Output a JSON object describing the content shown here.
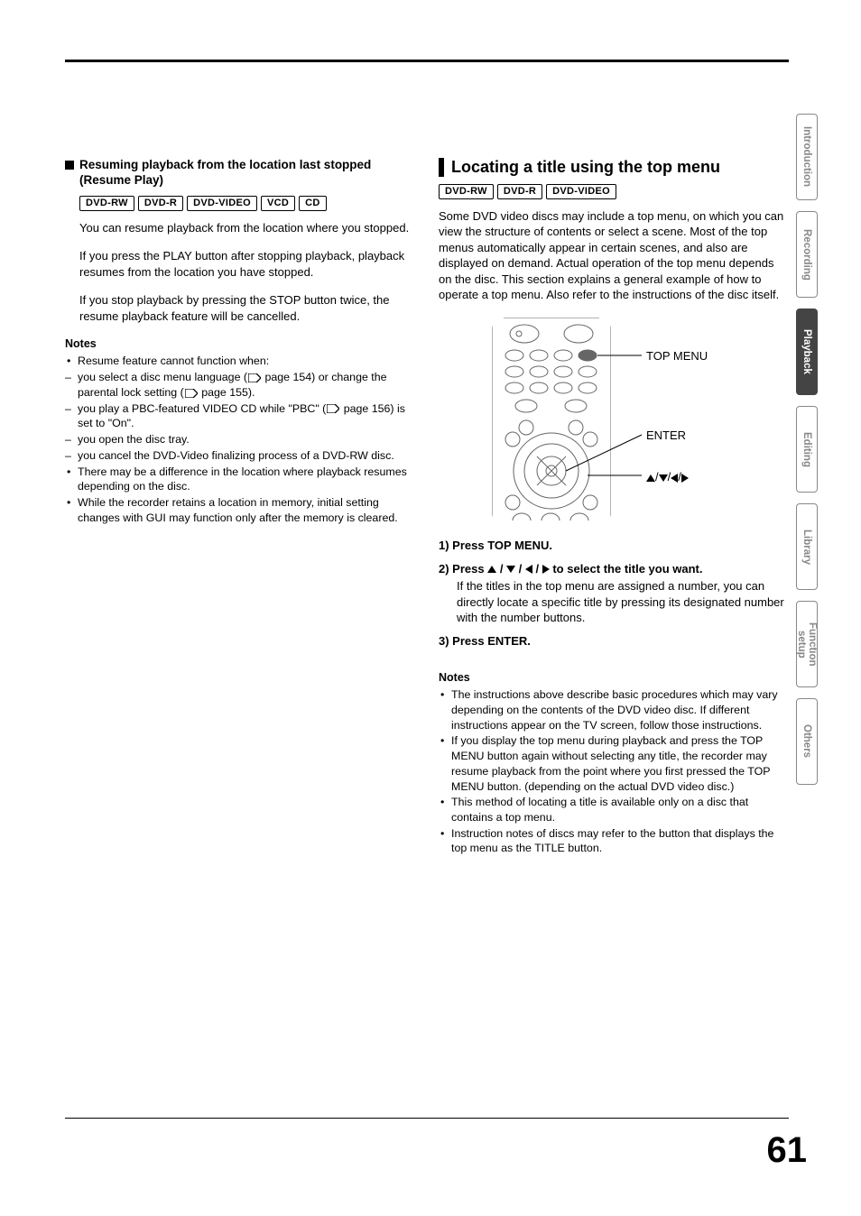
{
  "left": {
    "heading": "Resuming playback from the location last stopped (Resume Play)",
    "badges": [
      "DVD-RW",
      "DVD-R",
      "DVD-VIDEO",
      "VCD",
      "CD"
    ],
    "p1": "You can resume playback from the location where you stopped.",
    "p2": "If you press the PLAY button after stopping playback, playback resumes from the location you have stopped.",
    "p3": "If you stop playback by pressing the STOP button twice, the resume playback feature will be cancelled.",
    "notes_hd": "Notes",
    "note1": "Resume feature cannot function when:",
    "note2a": "you select a disc menu language (",
    "note2b": " page 154) or change the parental lock setting (",
    "note2c": " page 155).",
    "note3a": "you play a PBC-featured VIDEO CD while \"PBC\" (",
    "note3b": " page 156) is set to \"On\".",
    "note4": "you open the disc tray.",
    "note5": "you cancel the DVD-Video finalizing process of a DVD-RW disc.",
    "note6": "There may be a difference in the location where playback resumes depending on the disc.",
    "note7": "While the recorder retains a location in memory, initial setting changes with GUI may function only after the memory is cleared."
  },
  "right": {
    "heading": "Locating a title using the top menu",
    "badges": [
      "DVD-RW",
      "DVD-R",
      "DVD-VIDEO"
    ],
    "intro": "Some DVD video discs may include a top menu, on which you can view the structure of contents or select a scene. Most of the top menus automatically appear in certain scenes, and also are displayed on demand. Actual operation of the top menu depends on the disc. This section explains a general example of how to operate a top menu. Also refer to the instructions of the disc itself.",
    "label_topmenu": "TOP MENU",
    "label_enter": "ENTER",
    "step1": "1) Press TOP MENU.",
    "step2_lead": "2) Press ",
    "step2_tail": " to select the title you want.",
    "step2_body": "If the titles in the top menu are assigned a number, you can directly locate a specific title by pressing its designated number with the number buttons.",
    "step3": "3) Press ENTER.",
    "notes_hd": "Notes",
    "rnote1": "The instructions above describe basic procedures which may vary depending on the contents of the DVD video disc. If different instructions appear on the TV screen, follow those instructions.",
    "rnote2": "If you display the top menu during playback and press the TOP MENU button again without selecting any title, the recorder may resume playback from the point where you first pressed the TOP MENU button. (depending on the actual DVD video disc.)",
    "rnote3": "This method of locating a title is available only on a disc that contains a top menu.",
    "rnote4": "Instruction notes of discs may refer to the button that displays the top menu as the TITLE button."
  },
  "tabs": [
    "Introduction",
    "Recording",
    "Playback",
    "Editing",
    "Library",
    "Function setup",
    "Others"
  ],
  "page_number": "61"
}
